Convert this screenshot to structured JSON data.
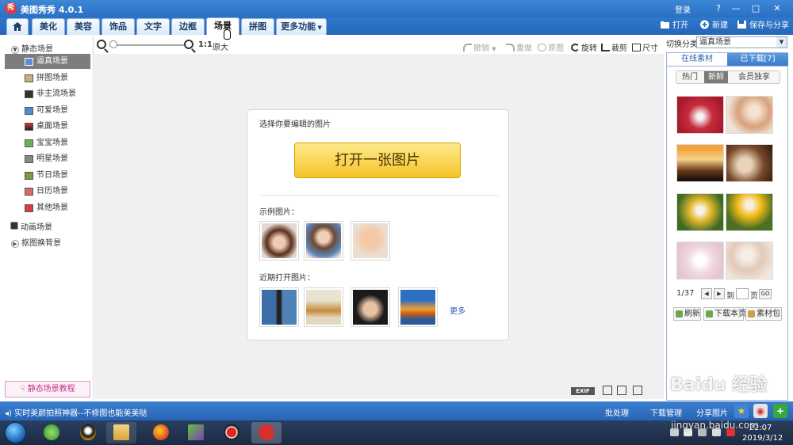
{
  "app": {
    "title": "美图秀秀 4.0.1",
    "logo_glyph": "秀",
    "login": "登录",
    "window_buttons": [
      "?",
      "—",
      "□",
      "✕"
    ]
  },
  "menu": {
    "home_icon": "home-icon",
    "tabs": [
      "美化",
      "美容",
      "饰品",
      "文字",
      "边框",
      "场景",
      "拼图"
    ],
    "active_tab": "场景",
    "more": "更多功能",
    "right_tools": {
      "open": "打开",
      "new": "新建",
      "save": "保存与分享"
    }
  },
  "sidebar": {
    "static_group": "静态场景",
    "items": [
      "逼真场景",
      "拼图场景",
      "非主流场景",
      "可爱场景",
      "桌面场景",
      "宝宝场景",
      "明星场景",
      "节日场景",
      "日历场景",
      "其他场景"
    ],
    "selected_item": "逼真场景",
    "animated_group": "动画场景",
    "matting_group": "抠图换背景",
    "tutorial": "静态场景教程"
  },
  "toolbar": {
    "zoom_ratio": "1:1",
    "original_size": "原大",
    "undo": "撤销",
    "redo": "重做",
    "original_image": "原图",
    "rotate": "旋转",
    "crop": "裁剪",
    "resize": "尺寸"
  },
  "welcome": {
    "prompt": "选择你要编辑的图片",
    "open_button": "打开一张图片",
    "examples_label": "示例图片：",
    "recent_label": "近期打开图片：",
    "more": "更多"
  },
  "right_panel": {
    "category_label": "切换分类",
    "category_value": "逼真场景",
    "tab_online": "在线素材",
    "tab_downloaded": "已下载[7]",
    "subtabs": [
      "热门",
      "新鲜",
      "会员独享"
    ],
    "active_subtab": "新鲜",
    "page_indicator": "1/37",
    "goto_label": "到",
    "page_label": "页",
    "go_button": "GO",
    "refresh": "刷新",
    "download_page": "下载本页",
    "material_pack": "素材包"
  },
  "canvas_footer": {
    "exif": "EXIF"
  },
  "statusbar": {
    "tip": "实时美颜拍照神器--不修图也能美美哒",
    "batch": "批处理",
    "download_manage": "下载管理",
    "share": "分享图片"
  },
  "taskbar": {
    "time": "22:07",
    "date": "2019/3/12"
  },
  "watermark": {
    "brand": "Baidu 经验",
    "url": "jingyan.baidu.com"
  },
  "colors": {
    "title_blue": "#2a6fc3",
    "open_button": "#f6c42b",
    "selected_item": "#7d7d7d",
    "tutorial_pink": "#c0308a"
  }
}
